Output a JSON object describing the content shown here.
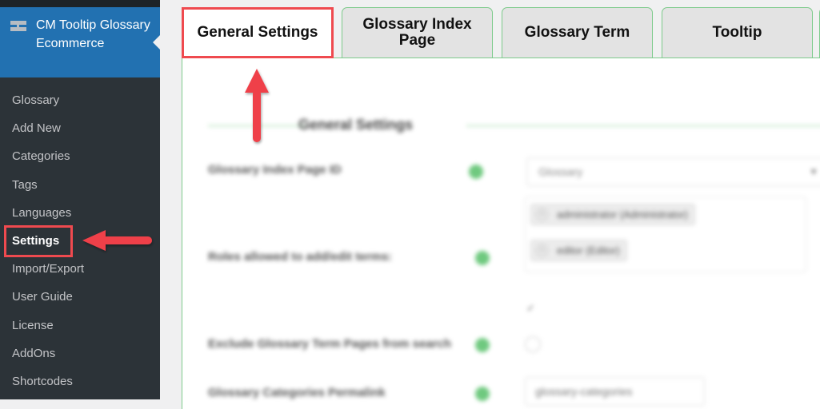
{
  "sidebar": {
    "plugin_icon": "plugin-menu-icon",
    "plugin_title": "CM Tooltip Glossary Ecommerce",
    "items": [
      {
        "label": "Glossary",
        "active": false
      },
      {
        "label": "Add New",
        "active": false
      },
      {
        "label": "Categories",
        "active": false
      },
      {
        "label": "Tags",
        "active": false
      },
      {
        "label": "Languages",
        "active": false
      },
      {
        "label": "Settings",
        "active": true
      },
      {
        "label": "Import/Export",
        "active": false
      },
      {
        "label": "User Guide",
        "active": false
      },
      {
        "label": "License",
        "active": false
      },
      {
        "label": "AddOns",
        "active": false
      },
      {
        "label": "Shortcodes",
        "active": false
      }
    ]
  },
  "tabs": [
    {
      "label": "General Settings",
      "active": true
    },
    {
      "label": "Glossary Index Page",
      "active": false
    },
    {
      "label": "Glossary Term",
      "active": false
    },
    {
      "label": "Tooltip",
      "active": false
    },
    {
      "label": "",
      "active": false
    }
  ],
  "panel": {
    "section_title": "General Settings",
    "rows": [
      {
        "label": "Glossary Index Page ID",
        "help_icon": "help-dot-icon"
      },
      {
        "label": "Roles allowed to add/edit terms:",
        "help_icon": "help-dot-icon"
      },
      {
        "label": "Exclude Glossary Term Pages from search",
        "help_icon": "help-dot-icon"
      },
      {
        "label": "Glossary Categories Permalink",
        "help_icon": "help-dot-icon"
      }
    ],
    "index_page_select": {
      "value": "Glossary",
      "icon": "chevron-down-icon"
    },
    "roles_chips": [
      {
        "label": "administrator (Administrator)",
        "remove_icon": "remove-icon"
      },
      {
        "label": "editor (Editor)",
        "remove_icon": "remove-icon"
      }
    ],
    "checkmark": "✓",
    "categories_permalink_value": "glossary-categories"
  },
  "annotations": {
    "highlight_color": "#ef4a4f",
    "arrow_icons": [
      "arrow-left-icon",
      "arrow-up-icon"
    ]
  },
  "colors": {
    "sidebar_bg": "#2c3338",
    "sidebar_active_bg": "#2271b1",
    "tab_border": "#7ecb8c",
    "help_dot": "#6fc97f"
  }
}
